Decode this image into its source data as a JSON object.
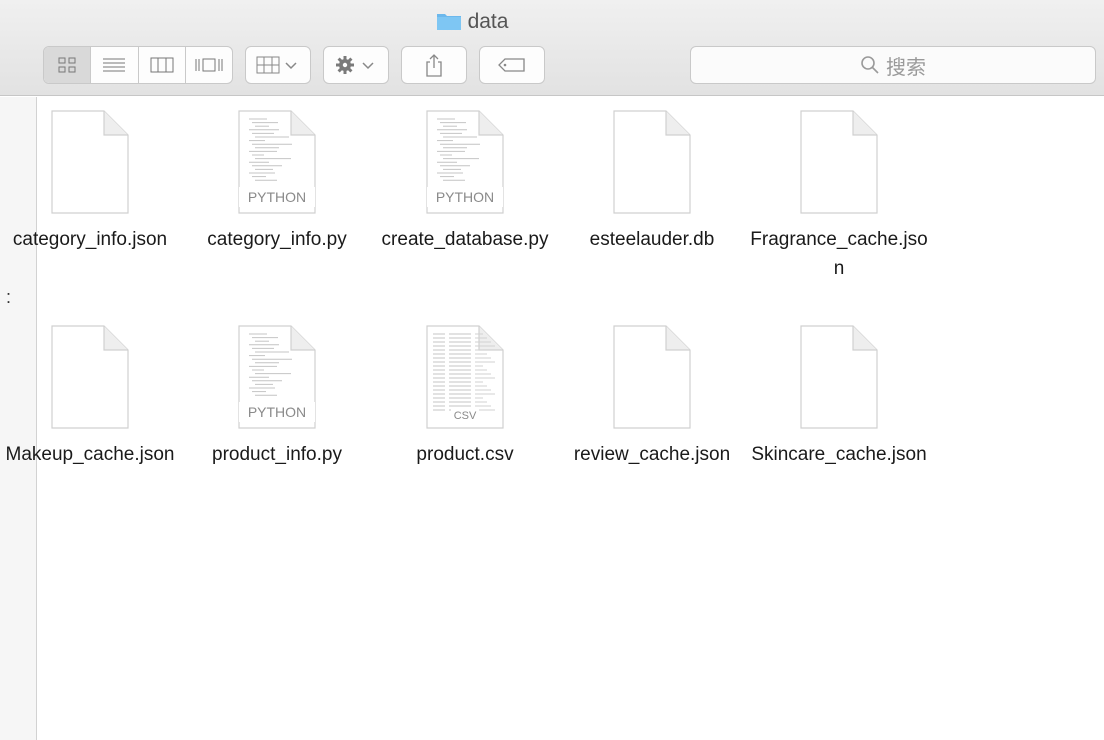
{
  "window": {
    "title": "data"
  },
  "toolbar": {
    "view_buttons": [
      "icon-view",
      "list-view",
      "column-view",
      "cover-flow-view"
    ],
    "arrange_icon": "arrange-icon",
    "action_icon": "gear-icon",
    "share_icon": "share-icon",
    "tag_icon": "tag-icon"
  },
  "search": {
    "placeholder": "搜索"
  },
  "files": [
    {
      "name": "category_info.json",
      "kind": "blank"
    },
    {
      "name": "category_info.py",
      "kind": "python",
      "badge": "PYTHON"
    },
    {
      "name": "create_database.py",
      "kind": "python",
      "badge": "PYTHON"
    },
    {
      "name": "esteelauder.db",
      "kind": "blank"
    },
    {
      "name": "Fragrance_cache.json",
      "kind": "blank"
    },
    {
      "name": "Makeup_cache.json",
      "kind": "blank"
    },
    {
      "name": "product_info.py",
      "kind": "python",
      "badge": "PYTHON"
    },
    {
      "name": "product.csv",
      "kind": "csv",
      "badge": "CSV"
    },
    {
      "name": "review_cache.json",
      "kind": "blank"
    },
    {
      "name": "Skincare_cache.json",
      "kind": "blank"
    }
  ],
  "colors": {
    "folder": "#6cb8ec",
    "toolbar_bg": "#e6e6e6",
    "text": "#1a1a1a"
  }
}
